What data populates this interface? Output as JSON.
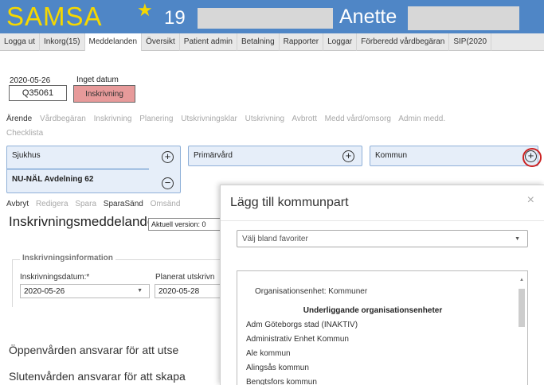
{
  "header": {
    "app_title": "SAMSA",
    "count": "19",
    "username": "Anette"
  },
  "menu": [
    "Logga ut",
    "Inkorg(15)",
    "Meddelanden",
    "Översikt",
    "Patient admin",
    "Betalning",
    "Rapporter",
    "Loggar",
    "Förberedd vårdbegäran",
    "SIP(2020"
  ],
  "case": {
    "date": "2020-05-26",
    "no_date_label": "Inget datum",
    "case_id": "Q35061",
    "status": "Inskrivning"
  },
  "process_tabs": [
    "Ärende",
    "Vårdbegäran",
    "Inskrivning",
    "Planering",
    "Utskrivningsklar",
    "Utskrivning",
    "Avbrott",
    "Medd vård/omsorg",
    "Admin medd.",
    "Checklista"
  ],
  "parties": {
    "sjukhus": "Sjukhus",
    "sjukhus_ward": "NU-NÄL Avdelning 62",
    "primarvard": "Primärvård",
    "kommun": "Kommun"
  },
  "actions": [
    "Avbryt",
    "Redigera",
    "Spara",
    "SparaSänd",
    "Omsänd"
  ],
  "message": {
    "title": "Inskrivningsmeddelande",
    "version": "Aktuell version: 0"
  },
  "form": {
    "legend": "Inskrivningsinformation",
    "inskrivningsdatum_label": "Inskrivningsdatum:*",
    "inskrivningsdatum_value": "2020-05-26",
    "planerat_label": "Planerat utskrivn",
    "planerat_value": "2020-05-28"
  },
  "body": {
    "line1": "Öppenvården ansvarar för att utse",
    "line2": "Slutenvården ansvarar för att skapa"
  },
  "modal": {
    "title": "Lägg till kommunpart",
    "close": "×",
    "favorites_placeholder": "Välj bland favoriter",
    "org_heading": "Organisationsenhet: Kommuner",
    "org_subheading": "Underliggande organisationsenheter",
    "orgs": [
      "Adm Göteborgs stad (INAKTIV)",
      "Administrativ Enhet Kommun",
      "Ale kommun",
      "Alingsås kommun",
      "Bengtsfors kommun"
    ]
  }
}
